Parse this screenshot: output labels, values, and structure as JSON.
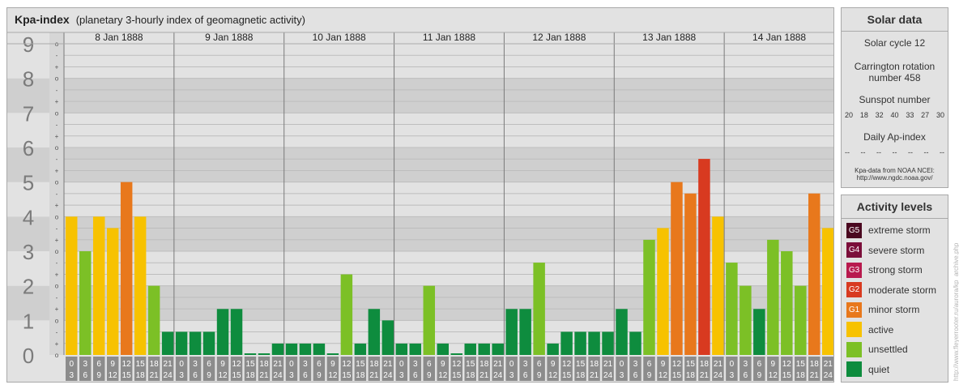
{
  "main": {
    "title": "Kpa-index",
    "subtitle": "(planetary 3-hourly index of geomagnetic activity)"
  },
  "chart_data": {
    "type": "bar",
    "title": "Kpa-index",
    "subtitle": "(planetary 3-hourly index of geomagnetic activity)",
    "ylim": [
      0,
      9
    ],
    "y_ticks": [
      "0",
      "1",
      "2",
      "3",
      "4",
      "5",
      "6",
      "7",
      "8",
      "9"
    ],
    "y_subticks": [
      "-",
      "o",
      "+"
    ],
    "days": [
      "8 Jan 1888",
      "9 Jan 1888",
      "10 Jan 1888",
      "11 Jan 1888",
      "12 Jan 1888",
      "13 Jan 1888",
      "14 Jan 1888"
    ],
    "interval_labels": [
      [
        "0",
        "3"
      ],
      [
        "3",
        "6"
      ],
      [
        "6",
        "9"
      ],
      [
        "9",
        "12"
      ],
      [
        "12",
        "15"
      ],
      [
        "15",
        "18"
      ],
      [
        "18",
        "21"
      ],
      [
        "21",
        "24"
      ]
    ],
    "values": [
      [
        4.0,
        3.0,
        4.0,
        3.67,
        5.0,
        4.0,
        2.0,
        0.67
      ],
      [
        0.67,
        0.67,
        0.67,
        1.33,
        1.33,
        0.0,
        0.0,
        0.33
      ],
      [
        0.33,
        0.33,
        0.33,
        0.0,
        2.33,
        0.33,
        1.33,
        1.0
      ],
      [
        0.33,
        0.33,
        2.0,
        0.33,
        0.0,
        0.33,
        0.33,
        0.33
      ],
      [
        1.33,
        1.33,
        2.67,
        0.33,
        0.67,
        0.67,
        0.67,
        0.67
      ],
      [
        1.33,
        0.67,
        3.33,
        3.67,
        5.0,
        4.67,
        5.67,
        4.0
      ],
      [
        2.67,
        2.0,
        1.33,
        3.33,
        3.0,
        2.0,
        4.67,
        3.67
      ]
    ],
    "grid": true
  },
  "solar": {
    "title": "Solar data",
    "cycle": "Solar cycle 12",
    "carrington_line1": "Carrington rotation",
    "carrington_line2": "number 458",
    "sunspot_title": "Sunspot number",
    "sunspot_values": [
      "20",
      "18",
      "32",
      "40",
      "33",
      "27",
      "30"
    ],
    "ap_title": "Daily Ap-index",
    "ap_values": [
      "--",
      "--",
      "--",
      "--",
      "--",
      "--",
      "--"
    ],
    "source_line1": "Kpa-data from NOAA NCEI:",
    "source_line2": "http://www.ngdc.noaa.gov/"
  },
  "activity": {
    "title": "Activity levels",
    "levels": [
      {
        "code": "G5",
        "label": "extreme storm",
        "color": "#4a0820"
      },
      {
        "code": "G4",
        "label": "severe storm",
        "color": "#7b0e3a"
      },
      {
        "code": "G3",
        "label": "strong storm",
        "color": "#b81a4e"
      },
      {
        "code": "G2",
        "label": "moderate storm",
        "color": "#d83a20"
      },
      {
        "code": "G1",
        "label": "minor storm",
        "color": "#e8781c"
      },
      {
        "code": "",
        "label": "active",
        "color": "#f7c200"
      },
      {
        "code": "",
        "label": "unsettled",
        "color": "#7cc026"
      },
      {
        "code": "",
        "label": "quiet",
        "color": "#0e8c3e"
      }
    ]
  },
  "watermark": "http://www.fleyerrooter.ru/aurora/kp_archive.php"
}
